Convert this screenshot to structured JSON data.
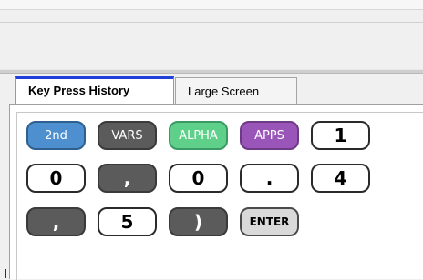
{
  "tabs": [
    {
      "label": "Key Press History",
      "active": true
    },
    {
      "label": "Large Screen",
      "active": false
    }
  ],
  "keys": [
    {
      "label": "2nd",
      "style": "blue"
    },
    {
      "label": "VARS",
      "style": "dark"
    },
    {
      "label": "ALPHA",
      "style": "green"
    },
    {
      "label": "APPS",
      "style": "purple"
    },
    {
      "label": "1",
      "style": "white"
    },
    {
      "label": "0",
      "style": "white"
    },
    {
      "label": ",",
      "style": "dark"
    },
    {
      "label": "0",
      "style": "white"
    },
    {
      "label": ".",
      "style": "white"
    },
    {
      "label": "4",
      "style": "white"
    },
    {
      "label": ",",
      "style": "dark"
    },
    {
      "label": "5",
      "style": "white"
    },
    {
      "label": ")",
      "style": "dark"
    },
    {
      "label": "ENTER",
      "style": "gray"
    }
  ],
  "colors": {
    "active_tab_accent": "#1f3fd8",
    "key_blue": "#4d8fcf",
    "key_dark": "#5b5b5b",
    "key_green": "#5fd08a",
    "key_purple": "#9a55b8",
    "key_gray": "#d9d9d9"
  }
}
